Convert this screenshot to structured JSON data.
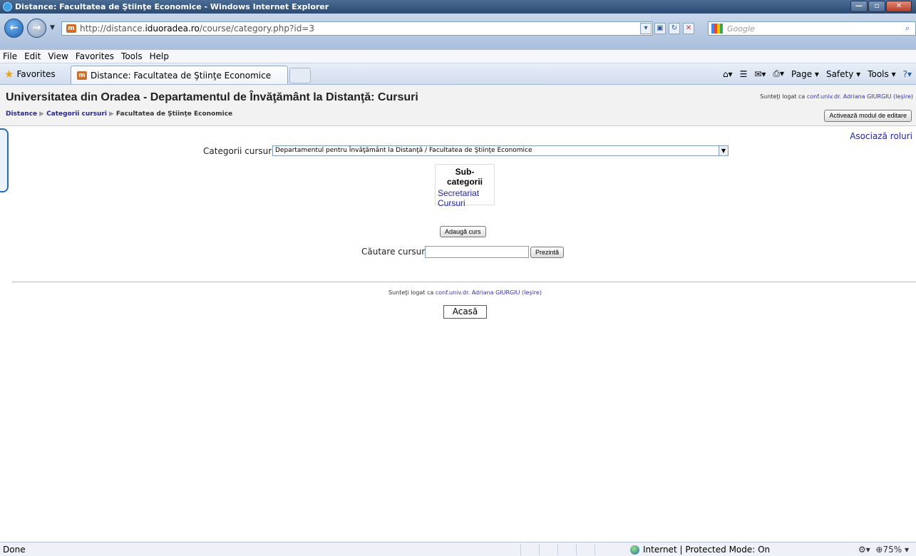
{
  "browser": {
    "window_title": "Distance: Facultatea de Ştiinţe Economice - Windows Internet Explorer",
    "url_prefix": "http://distance.",
    "url_host": "iduoradea.ro",
    "url_path": "/course/category.php?id=3",
    "search_placeholder": "Google",
    "menu": [
      "File",
      "Edit",
      "View",
      "Favorites",
      "Tools",
      "Help"
    ],
    "favorites_label": "Favorites",
    "tab_title": "Distance: Facultatea de Ştiinţe Economice",
    "command_items": [
      "Page",
      "Safety",
      "Tools"
    ],
    "status_text": "Done",
    "zone_text": "Internet | Protected Mode: On",
    "zoom_text": "75%"
  },
  "header": {
    "site_title": "Universitatea din Oradea - Departamentul de Învăţământ la Distanţă: Cursuri",
    "logged_prefix": "Sunteţi logat ca",
    "user_name": "conf.univ.dr. Adriana GIURGIU",
    "logout": "(Ieşire)",
    "edit_button": "Activează modul de editare"
  },
  "breadcrumb": {
    "items": [
      "Distance",
      "Categorii cursuri",
      "Facultatea de Ştiinţe Economice"
    ]
  },
  "main": {
    "assign_roles": "Asociază roluri",
    "category_label": "Categorii cursuri:",
    "category_value": "Departamentul pentru Învăţământ la Distanţă / Facultatea de Ştiinţe Economice",
    "subcategories_heading": "Sub-categorii",
    "subcategories": [
      "Secretariat",
      "Cursuri"
    ],
    "add_course_button": "Adaugă curs",
    "search_label": "Căutare cursuri:",
    "search_button": "Prezintă"
  },
  "footer": {
    "logged_prefix": "Sunteţi logat ca",
    "user_name": "conf.univ.dr. Adriana GIURGIU",
    "logout": "(Ieşire)",
    "home_button": "Acasă"
  }
}
